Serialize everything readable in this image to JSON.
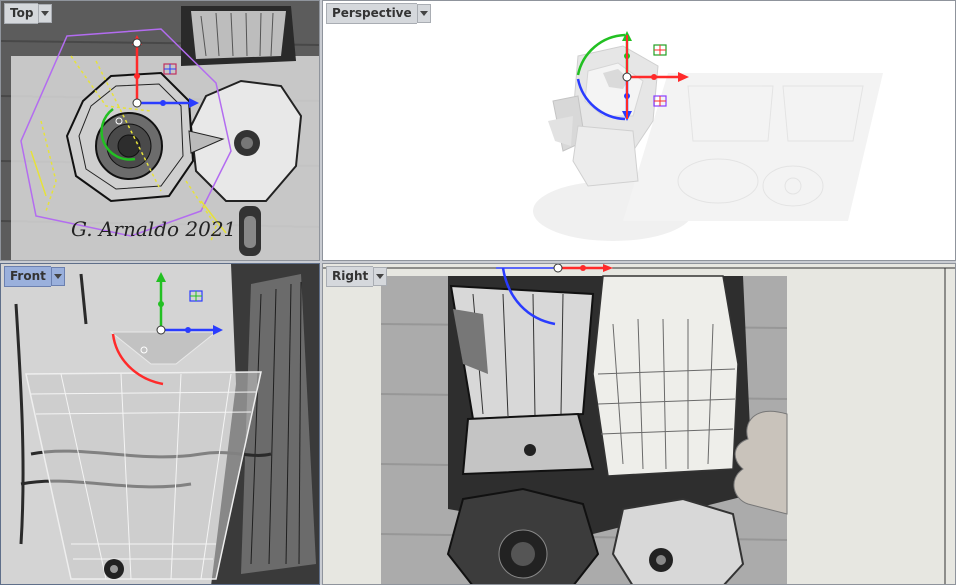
{
  "viewports": [
    {
      "name": "Top",
      "active": false
    },
    {
      "name": "Perspective",
      "active": false
    },
    {
      "name": "Front",
      "active": true
    },
    {
      "name": "Right",
      "active": false
    }
  ],
  "gizmo_colors": {
    "x": "#ff2a2a",
    "y": "#22c022",
    "z": "#2a3cff"
  },
  "signature": "G. Arnaldo 2021"
}
